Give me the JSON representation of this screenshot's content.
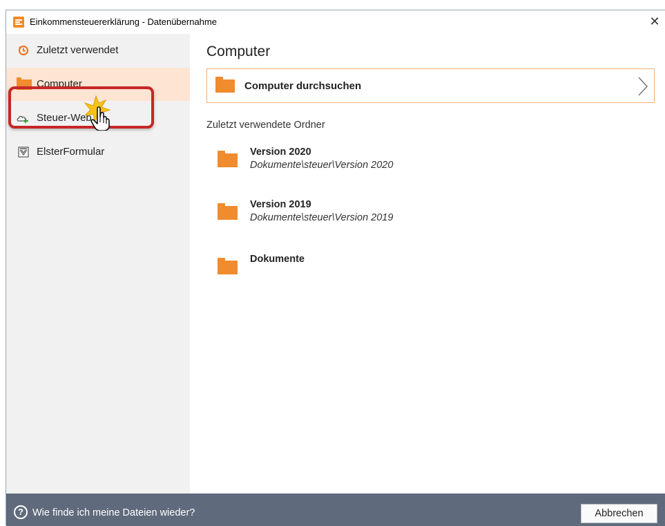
{
  "window": {
    "title": "Einkommensteuererklärung - Datenübernahme",
    "close": "✕"
  },
  "sidebar": {
    "items": [
      {
        "label": "Zuletzt verwendet",
        "icon": "clock-icon"
      },
      {
        "label": "Computer",
        "icon": "folder-icon",
        "active": true
      },
      {
        "label": "Steuer-Web",
        "icon": "cloud-icon"
      },
      {
        "label": "ElsterFormular",
        "icon": "elster-icon"
      }
    ]
  },
  "main": {
    "title": "Computer",
    "browse_label": "Computer durchsuchen",
    "recent_heading": "Zuletzt verwendete Ordner",
    "recent": [
      {
        "name": "Version 2020",
        "path": "Dokumente\\steuer\\Version 2020"
      },
      {
        "name": "Version 2019",
        "path": "Dokumente\\steuer\\Version 2019"
      },
      {
        "name": "Dokumente",
        "path": ""
      }
    ]
  },
  "footer": {
    "help_icon": "?",
    "help_text": "Wie finde ich meine Dateien wieder?",
    "cancel": "Abbrechen"
  },
  "colors": {
    "accent": "#f08b2e",
    "footer": "#5f6b7c",
    "active_bg": "#fde4d3",
    "highlight": "#c62727"
  }
}
